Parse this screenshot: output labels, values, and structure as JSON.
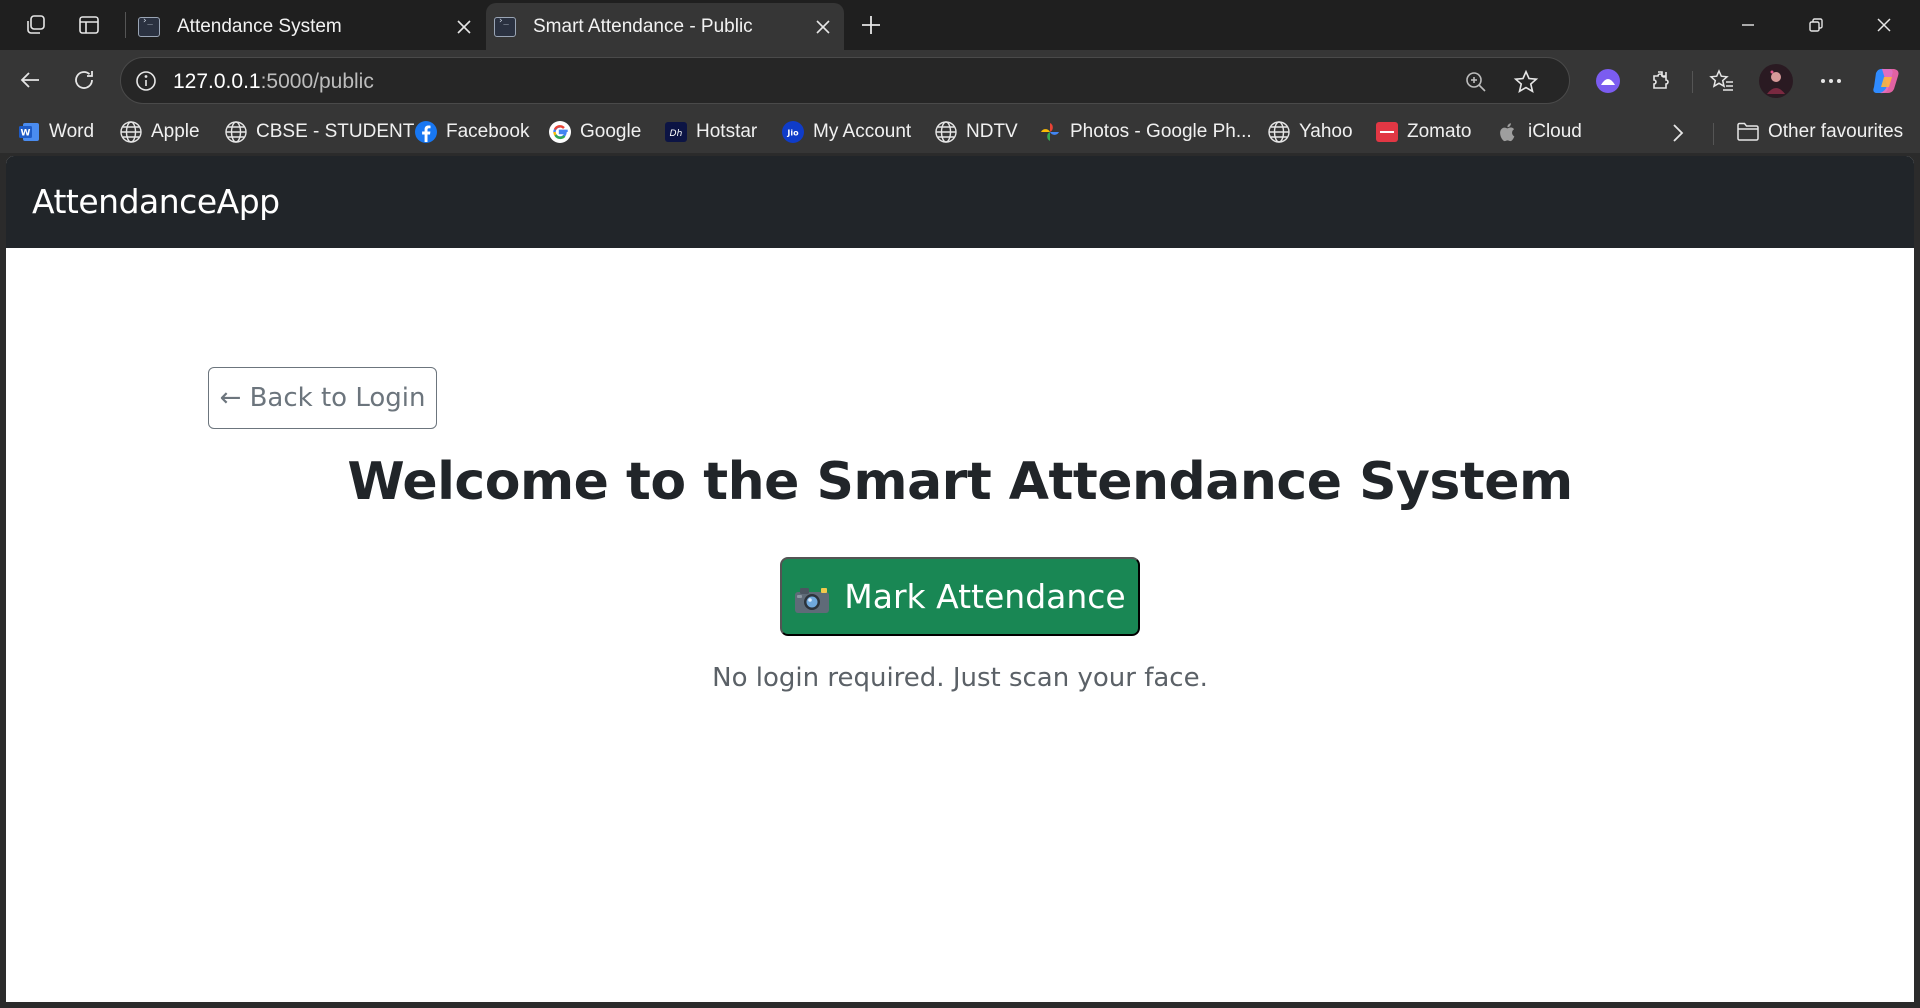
{
  "browser": {
    "tabs": [
      {
        "title": "Attendance System",
        "active": false
      },
      {
        "title": "Smart Attendance - Public",
        "active": true
      }
    ],
    "address": {
      "host": "127.0.0.1",
      "path": ":5000/public"
    },
    "favorites": [
      {
        "label": "Word",
        "icon": "word-icon"
      },
      {
        "label": "Apple",
        "icon": "globe-icon"
      },
      {
        "label": "CBSE - STUDENT",
        "icon": "globe-icon"
      },
      {
        "label": "Facebook",
        "icon": "facebook-icon"
      },
      {
        "label": "Google",
        "icon": "google-icon"
      },
      {
        "label": "Hotstar",
        "icon": "hotstar-icon"
      },
      {
        "label": "My Account",
        "icon": "jio-icon"
      },
      {
        "label": "NDTV",
        "icon": "globe-icon"
      },
      {
        "label": "Photos - Google Ph...",
        "icon": "photos-icon"
      },
      {
        "label": "Yahoo",
        "icon": "globe-icon"
      },
      {
        "label": "Zomato",
        "icon": "zomato-icon"
      },
      {
        "label": "iCloud",
        "icon": "apple-icon"
      }
    ],
    "other_favourites": "Other favourites",
    "colors": {
      "tabbar": "#1f1f1f",
      "toolbar": "#363636",
      "omnibox": "#262626"
    }
  },
  "app": {
    "brand": "AttendanceApp",
    "back_button": "← Back to Login",
    "heading": "Welcome to the Smart Attendance System",
    "mark_button": "Mark Attendance",
    "mark_icon": "camera-icon",
    "subtext": "No login required. Just scan your face.",
    "colors": {
      "navbar": "#212529",
      "primary_action": "#198754",
      "secondary": "#6c757d"
    }
  }
}
